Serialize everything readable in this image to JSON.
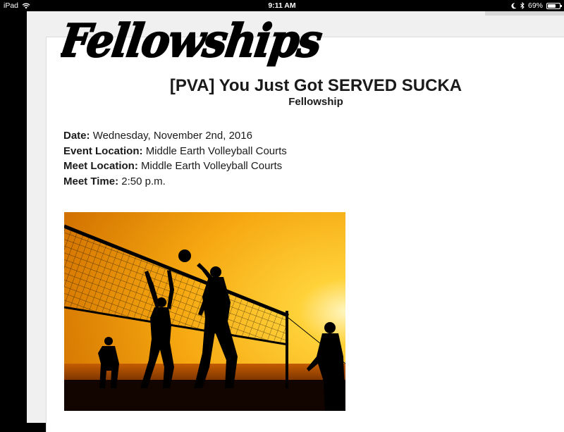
{
  "status_bar": {
    "device": "iPad",
    "time": "9:11 AM",
    "battery": "69%",
    "battery_level": 0.69
  },
  "logo": {
    "text": "Fellowships"
  },
  "event": {
    "title": "[PVA] You Just Got SERVED SUCKA",
    "subtitle": "Fellowship"
  },
  "details": {
    "date_label": "Date:",
    "date_value": "Wednesday, November 2nd, 2016",
    "event_location_label": "Event Location:",
    "event_location_value": "Middle Earth Volleyball Courts",
    "meet_location_label": "Meet Location:",
    "meet_location_value": "Middle Earth Volleyball Courts",
    "meet_time_label": "Meet Time:",
    "meet_time_value": "2:50 p.m."
  },
  "colors": {
    "sunset_light": "#ffd23a",
    "sunset_mid": "#f6a710",
    "sunset_dark": "#d27200",
    "silhouette": "#000000"
  }
}
